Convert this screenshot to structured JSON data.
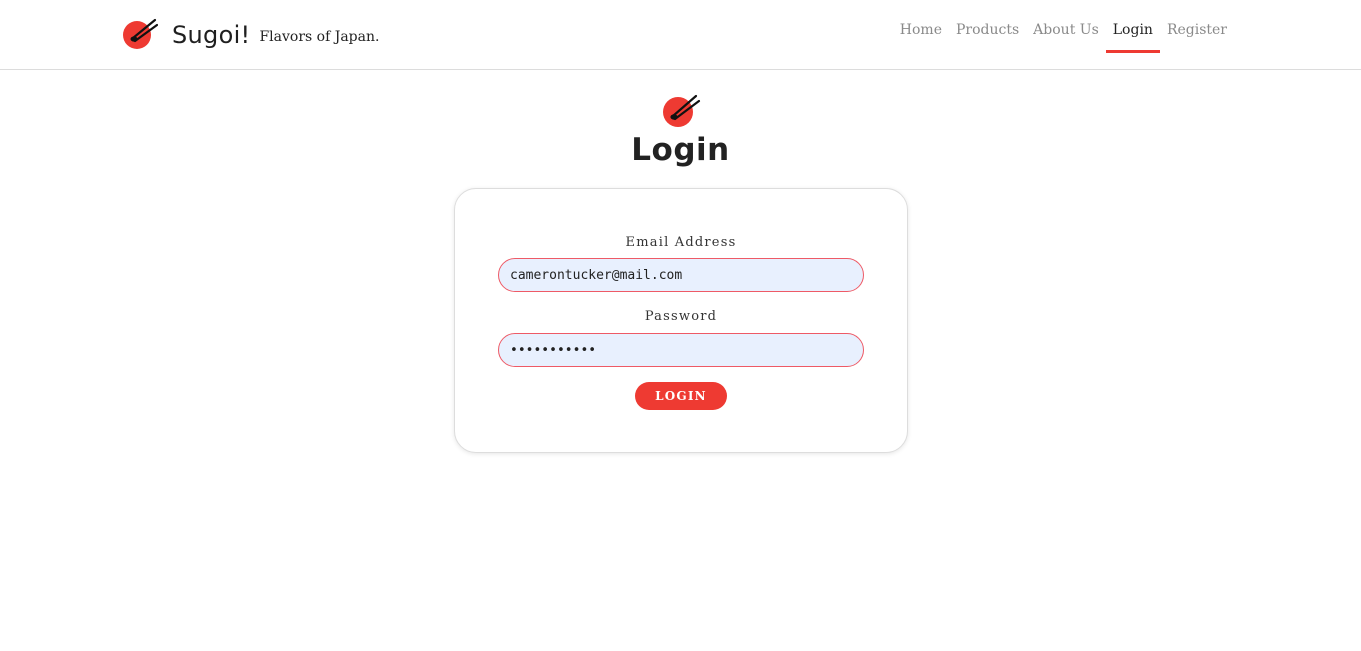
{
  "brand": {
    "name": "Sugoi!",
    "tagline": "Flavors of Japan.",
    "logo_icon": "chopsticks-bowl-icon"
  },
  "nav": {
    "items": [
      {
        "label": "Home",
        "active": false
      },
      {
        "label": "Products",
        "active": false
      },
      {
        "label": "About Us",
        "active": false
      },
      {
        "label": "Login",
        "active": true
      },
      {
        "label": "Register",
        "active": false
      }
    ]
  },
  "page": {
    "title": "Login"
  },
  "form": {
    "email_label": "Email Address",
    "email_value": "camerontucker@mail.com",
    "password_label": "Password",
    "password_value": "•••••••••••",
    "submit_label": "LOGIN"
  },
  "colors": {
    "accent": "#ee3a32",
    "input_bg": "#e8f0fe",
    "input_border": "#ee5a66"
  }
}
